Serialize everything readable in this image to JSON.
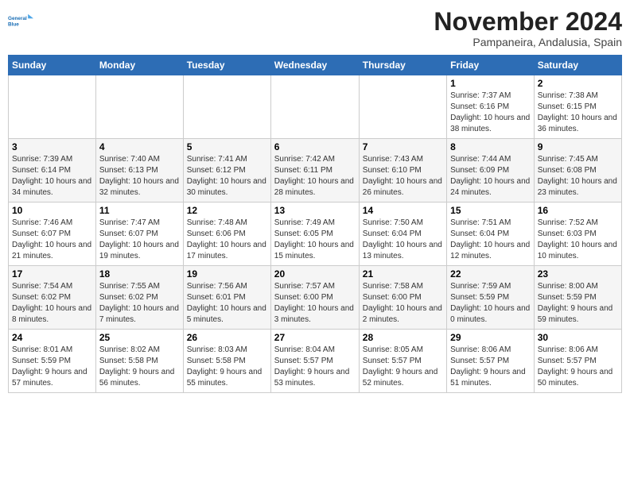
{
  "header": {
    "logo_line1": "General",
    "logo_line2": "Blue",
    "month": "November 2024",
    "location": "Pampaneira, Andalusia, Spain"
  },
  "days_of_week": [
    "Sunday",
    "Monday",
    "Tuesday",
    "Wednesday",
    "Thursday",
    "Friday",
    "Saturday"
  ],
  "weeks": [
    [
      {
        "day": "",
        "info": ""
      },
      {
        "day": "",
        "info": ""
      },
      {
        "day": "",
        "info": ""
      },
      {
        "day": "",
        "info": ""
      },
      {
        "day": "",
        "info": ""
      },
      {
        "day": "1",
        "info": "Sunrise: 7:37 AM\nSunset: 6:16 PM\nDaylight: 10 hours and 38 minutes."
      },
      {
        "day": "2",
        "info": "Sunrise: 7:38 AM\nSunset: 6:15 PM\nDaylight: 10 hours and 36 minutes."
      }
    ],
    [
      {
        "day": "3",
        "info": "Sunrise: 7:39 AM\nSunset: 6:14 PM\nDaylight: 10 hours and 34 minutes."
      },
      {
        "day": "4",
        "info": "Sunrise: 7:40 AM\nSunset: 6:13 PM\nDaylight: 10 hours and 32 minutes."
      },
      {
        "day": "5",
        "info": "Sunrise: 7:41 AM\nSunset: 6:12 PM\nDaylight: 10 hours and 30 minutes."
      },
      {
        "day": "6",
        "info": "Sunrise: 7:42 AM\nSunset: 6:11 PM\nDaylight: 10 hours and 28 minutes."
      },
      {
        "day": "7",
        "info": "Sunrise: 7:43 AM\nSunset: 6:10 PM\nDaylight: 10 hours and 26 minutes."
      },
      {
        "day": "8",
        "info": "Sunrise: 7:44 AM\nSunset: 6:09 PM\nDaylight: 10 hours and 24 minutes."
      },
      {
        "day": "9",
        "info": "Sunrise: 7:45 AM\nSunset: 6:08 PM\nDaylight: 10 hours and 23 minutes."
      }
    ],
    [
      {
        "day": "10",
        "info": "Sunrise: 7:46 AM\nSunset: 6:07 PM\nDaylight: 10 hours and 21 minutes."
      },
      {
        "day": "11",
        "info": "Sunrise: 7:47 AM\nSunset: 6:07 PM\nDaylight: 10 hours and 19 minutes."
      },
      {
        "day": "12",
        "info": "Sunrise: 7:48 AM\nSunset: 6:06 PM\nDaylight: 10 hours and 17 minutes."
      },
      {
        "day": "13",
        "info": "Sunrise: 7:49 AM\nSunset: 6:05 PM\nDaylight: 10 hours and 15 minutes."
      },
      {
        "day": "14",
        "info": "Sunrise: 7:50 AM\nSunset: 6:04 PM\nDaylight: 10 hours and 13 minutes."
      },
      {
        "day": "15",
        "info": "Sunrise: 7:51 AM\nSunset: 6:04 PM\nDaylight: 10 hours and 12 minutes."
      },
      {
        "day": "16",
        "info": "Sunrise: 7:52 AM\nSunset: 6:03 PM\nDaylight: 10 hours and 10 minutes."
      }
    ],
    [
      {
        "day": "17",
        "info": "Sunrise: 7:54 AM\nSunset: 6:02 PM\nDaylight: 10 hours and 8 minutes."
      },
      {
        "day": "18",
        "info": "Sunrise: 7:55 AM\nSunset: 6:02 PM\nDaylight: 10 hours and 7 minutes."
      },
      {
        "day": "19",
        "info": "Sunrise: 7:56 AM\nSunset: 6:01 PM\nDaylight: 10 hours and 5 minutes."
      },
      {
        "day": "20",
        "info": "Sunrise: 7:57 AM\nSunset: 6:00 PM\nDaylight: 10 hours and 3 minutes."
      },
      {
        "day": "21",
        "info": "Sunrise: 7:58 AM\nSunset: 6:00 PM\nDaylight: 10 hours and 2 minutes."
      },
      {
        "day": "22",
        "info": "Sunrise: 7:59 AM\nSunset: 5:59 PM\nDaylight: 10 hours and 0 minutes."
      },
      {
        "day": "23",
        "info": "Sunrise: 8:00 AM\nSunset: 5:59 PM\nDaylight: 9 hours and 59 minutes."
      }
    ],
    [
      {
        "day": "24",
        "info": "Sunrise: 8:01 AM\nSunset: 5:59 PM\nDaylight: 9 hours and 57 minutes."
      },
      {
        "day": "25",
        "info": "Sunrise: 8:02 AM\nSunset: 5:58 PM\nDaylight: 9 hours and 56 minutes."
      },
      {
        "day": "26",
        "info": "Sunrise: 8:03 AM\nSunset: 5:58 PM\nDaylight: 9 hours and 55 minutes."
      },
      {
        "day": "27",
        "info": "Sunrise: 8:04 AM\nSunset: 5:57 PM\nDaylight: 9 hours and 53 minutes."
      },
      {
        "day": "28",
        "info": "Sunrise: 8:05 AM\nSunset: 5:57 PM\nDaylight: 9 hours and 52 minutes."
      },
      {
        "day": "29",
        "info": "Sunrise: 8:06 AM\nSunset: 5:57 PM\nDaylight: 9 hours and 51 minutes."
      },
      {
        "day": "30",
        "info": "Sunrise: 8:06 AM\nSunset: 5:57 PM\nDaylight: 9 hours and 50 minutes."
      }
    ]
  ]
}
